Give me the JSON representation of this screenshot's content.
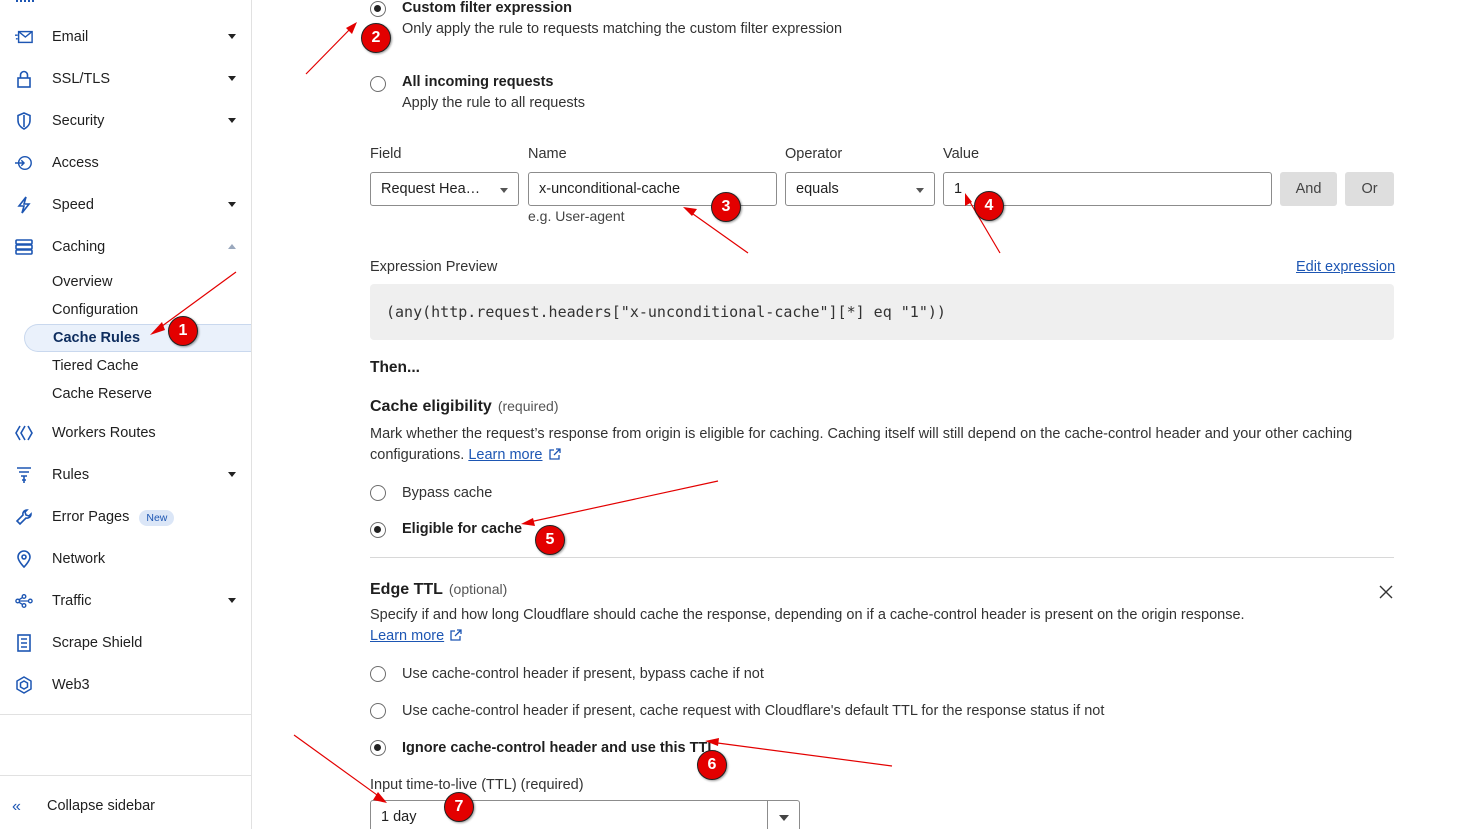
{
  "sidebar": {
    "items": [
      {
        "label": "Email",
        "icon": "envelope-icon",
        "expandable": true
      },
      {
        "label": "SSL/TLS",
        "icon": "lock-icon",
        "expandable": true
      },
      {
        "label": "Security",
        "icon": "shield-icon",
        "expandable": true
      },
      {
        "label": "Access",
        "icon": "access-icon",
        "expandable": false
      },
      {
        "label": "Speed",
        "icon": "lightning-icon",
        "expandable": true
      },
      {
        "label": "Caching",
        "icon": "server-stack-icon",
        "expandable": true,
        "expanded": true
      },
      {
        "label": "Workers Routes",
        "icon": "workers-icon",
        "expandable": false
      },
      {
        "label": "Rules",
        "icon": "funnel-icon",
        "expandable": true
      },
      {
        "label": "Error Pages",
        "icon": "wrench-icon",
        "expandable": false,
        "badge": "New"
      },
      {
        "label": "Network",
        "icon": "location-pin-icon",
        "expandable": false
      },
      {
        "label": "Traffic",
        "icon": "traffic-icon",
        "expandable": true
      },
      {
        "label": "Scrape Shield",
        "icon": "document-icon",
        "expandable": false
      },
      {
        "label": "Web3",
        "icon": "web3-icon",
        "expandable": false
      }
    ],
    "caching_sub": [
      "Overview",
      "Configuration",
      "Cache Rules",
      "Tiered Cache",
      "Cache Reserve"
    ],
    "active_sub": "Cache Rules",
    "collapse_label": "Collapse sidebar"
  },
  "match": {
    "custom": {
      "title": "Custom filter expression",
      "desc": "Only apply the rule to requests matching the custom filter expression",
      "checked": true
    },
    "all": {
      "title": "All incoming requests",
      "desc": "Apply the rule to all requests",
      "checked": false
    }
  },
  "expression_builder": {
    "field_label": "Field",
    "field_value": "Request Hea…",
    "name_label": "Name",
    "name_value": "x-unconditional-cache",
    "name_hint": "e.g. User-agent",
    "operator_label": "Operator",
    "operator_value": "equals",
    "value_label": "Value",
    "value_value": "1",
    "and_label": "And",
    "or_label": "Or"
  },
  "preview": {
    "label": "Expression Preview",
    "edit_link": "Edit expression",
    "code": "(any(http.request.headers[\"x-unconditional-cache\"][*] eq \"1\"))"
  },
  "then_label": "Then...",
  "cache_eligibility": {
    "title": "Cache eligibility",
    "req": "(required)",
    "desc1": "Mark whether the request’s response from origin is eligible for caching. Caching itself will still depend on the cache-control header and your other caching",
    "desc2": "configurations.",
    "learn_more": "Learn more",
    "options": [
      {
        "label": "Bypass cache",
        "checked": false
      },
      {
        "label": "Eligible for cache",
        "checked": true
      }
    ]
  },
  "edge_ttl": {
    "title": "Edge TTL",
    "opt": "(optional)",
    "desc": "Specify if and how long Cloudflare should cache the response, depending on if a cache-control header is present on the origin response.",
    "learn_more": "Learn more",
    "options": [
      {
        "label": "Use cache-control header if present, bypass cache if not",
        "checked": false
      },
      {
        "label": "Use cache-control header if present, cache request with Cloudflare's default TTL for the response status if not",
        "checked": false
      },
      {
        "label": "Ignore cache-control header and use this TTL",
        "checked": true
      }
    ],
    "ttl_label": "Input time-to-live (TTL) (required)",
    "ttl_value": "1 day"
  },
  "annotations": [
    "1",
    "2",
    "3",
    "4",
    "5",
    "6",
    "7"
  ],
  "colors": {
    "accent": "#1d56b3",
    "marker": "#e30000",
    "active_bg": "#eaf1fb"
  }
}
